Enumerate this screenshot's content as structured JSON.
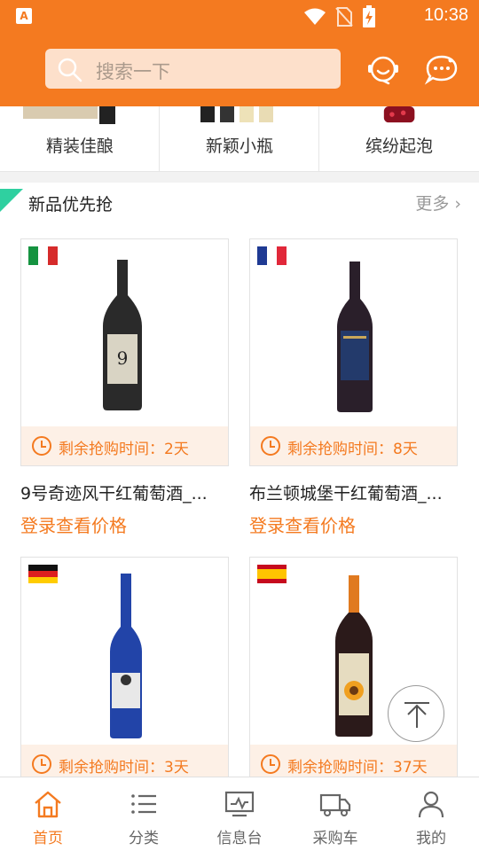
{
  "status_bar": {
    "time": "10:38"
  },
  "header": {
    "search_placeholder": "搜索一下",
    "icons": [
      "customer-service-icon",
      "chat-icon"
    ]
  },
  "categories": [
    {
      "label": "精装佳酿"
    },
    {
      "label": "新颖小瓶"
    },
    {
      "label": "缤纷起泡"
    }
  ],
  "section": {
    "title": "新品优先抢",
    "more": "更多"
  },
  "products": [
    {
      "name": "9号奇迹风干红葡萄酒_...",
      "timer": "剩余抢购时间：2天",
      "price": "登录查看价格",
      "flag": "italy",
      "bottle_color": "#2a2a2a",
      "label_color": "#d9d4c4"
    },
    {
      "name": "布兰顿城堡干红葡萄酒_...",
      "timer": "剩余抢购时间：8天",
      "price": "登录查看价格",
      "flag": "france",
      "bottle_color": "#2a1f2a",
      "label_color": "#233a6b"
    },
    {
      "name": "",
      "timer": "剩余抢购时间：3天",
      "price": "",
      "flag": "germany",
      "bottle_color": "#2244a8",
      "label_color": "#e8e8e8"
    },
    {
      "name": "",
      "timer": "剩余抢购时间：37天",
      "price": "",
      "flag": "spain",
      "bottle_color": "#2b1a1a",
      "label_color": "#e6dcc0"
    }
  ],
  "tabs": [
    {
      "label": "首页",
      "icon": "home-icon",
      "active": true
    },
    {
      "label": "分类",
      "icon": "list-icon",
      "active": false
    },
    {
      "label": "信息台",
      "icon": "monitor-icon",
      "active": false
    },
    {
      "label": "采购车",
      "icon": "truck-icon",
      "active": false
    },
    {
      "label": "我的",
      "icon": "user-icon",
      "active": false
    }
  ],
  "colors": {
    "brand": "#f47a20",
    "accent_corner": "#2fd0a0"
  }
}
